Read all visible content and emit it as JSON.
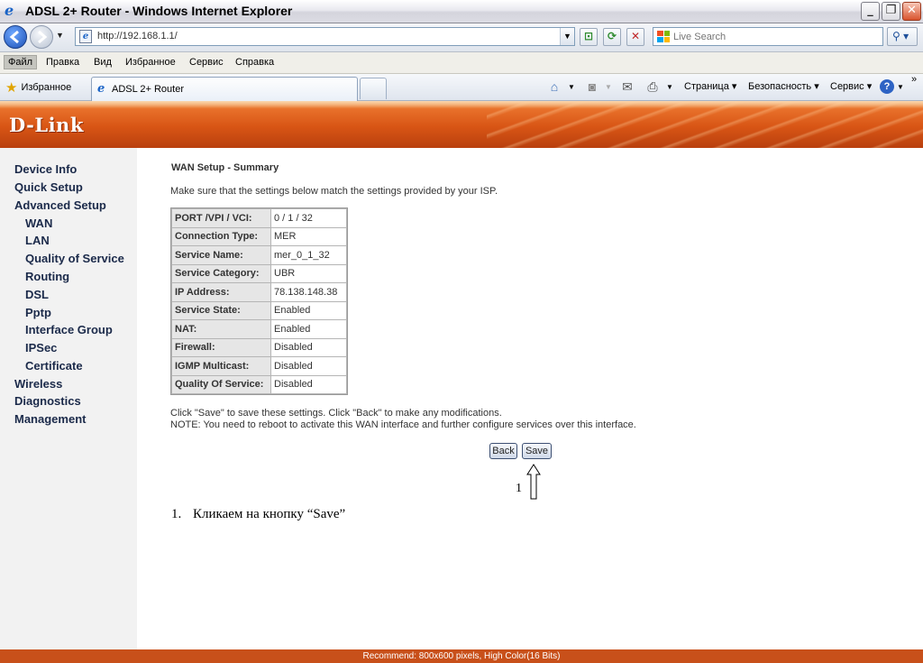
{
  "window": {
    "title": "ADSL 2+ Router - Windows Internet Explorer",
    "min_glyph": "_",
    "max_glyph": "❐",
    "close_glyph": "✕"
  },
  "addressbar": {
    "url": "http://192.168.1.1/",
    "search_placeholder": "Live Search",
    "search_glyph": "⚲ ▾"
  },
  "menubar": {
    "items": [
      "Файл",
      "Правка",
      "Вид",
      "Избранное",
      "Сервис",
      "Справка"
    ]
  },
  "tabbar": {
    "favorites": "Избранное",
    "tab_title": "ADSL 2+ Router",
    "commands": {
      "page": "Страница",
      "safety": "Безопасность",
      "tools": "Сервис"
    }
  },
  "brand": {
    "logo": "D-Link"
  },
  "nav": {
    "device_info": "Device Info",
    "quick_setup": "Quick Setup",
    "advanced_setup": "Advanced Setup",
    "wan": "WAN",
    "lan": "LAN",
    "qos": "Quality of Service",
    "routing": "Routing",
    "dsl": "DSL",
    "pptp": "Pptp",
    "interface_group": "Interface Group",
    "ipsec": "IPSec",
    "certificate": "Certificate",
    "wireless": "Wireless",
    "diagnostics": "Diagnostics",
    "management": "Management"
  },
  "main": {
    "title": "WAN Setup - Summary",
    "intro": "Make sure that the settings below match the settings provided by your ISP.",
    "rows": [
      {
        "key": "PORT /VPI / VCI:",
        "value": "0 / 1 / 32"
      },
      {
        "key": "Connection Type:",
        "value": "MER"
      },
      {
        "key": "Service Name:",
        "value": "mer_0_1_32"
      },
      {
        "key": "Service Category:",
        "value": "UBR"
      },
      {
        "key": "IP Address:",
        "value": "78.138.148.38"
      },
      {
        "key": "Service State:",
        "value": "Enabled"
      },
      {
        "key": "NAT:",
        "value": "Enabled"
      },
      {
        "key": "Firewall:",
        "value": "Disabled"
      },
      {
        "key": "IGMP Multicast:",
        "value": "Disabled"
      },
      {
        "key": "Quality Of Service:",
        "value": "Disabled"
      }
    ],
    "note1": "Click \"Save\" to save these settings. Click \"Back\" to make any modifications.",
    "note2": "NOTE: You need to reboot to activate this WAN interface and further configure services over this interface.",
    "back_label": "Back",
    "save_label": "Save"
  },
  "annotation": {
    "number": "1",
    "step_number": "1.",
    "text": "Кликаем на кнопку “Save”"
  },
  "footer": {
    "text": "Recommend: 800x600 pixels, High Color(16 Bits)"
  },
  "colors": {
    "header_orange": "#d85515",
    "footer_orange": "#c8501a",
    "nav_text": "#1b2a4a"
  }
}
